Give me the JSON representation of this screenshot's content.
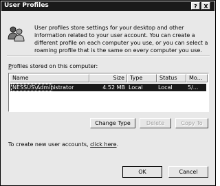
{
  "window": {
    "title": "User Profiles",
    "help_label": "?",
    "close_label": "X"
  },
  "description": "User profiles store settings for your desktop and other information related to your user account. You can create a different profile on each computer you use, or you can select a roaming profile that is the same on every computer you use.",
  "profiles_label": "Profiles stored on this computer:",
  "columns": [
    "Name",
    "Size",
    "Type",
    "Status",
    "Mo..."
  ],
  "rows": [
    {
      "name": "NESSUS\\Administrator",
      "size": "4.52 MB",
      "type": "Local",
      "status": "Local",
      "modified": "5/..."
    }
  ],
  "buttons": {
    "change_type": "Change Type",
    "delete": "Delete",
    "copy_to": "Copy To",
    "ok": "OK",
    "cancel": "Cancel"
  },
  "footer": {
    "text": "To create new user accounts, ",
    "link": "click here",
    "suffix": "."
  }
}
